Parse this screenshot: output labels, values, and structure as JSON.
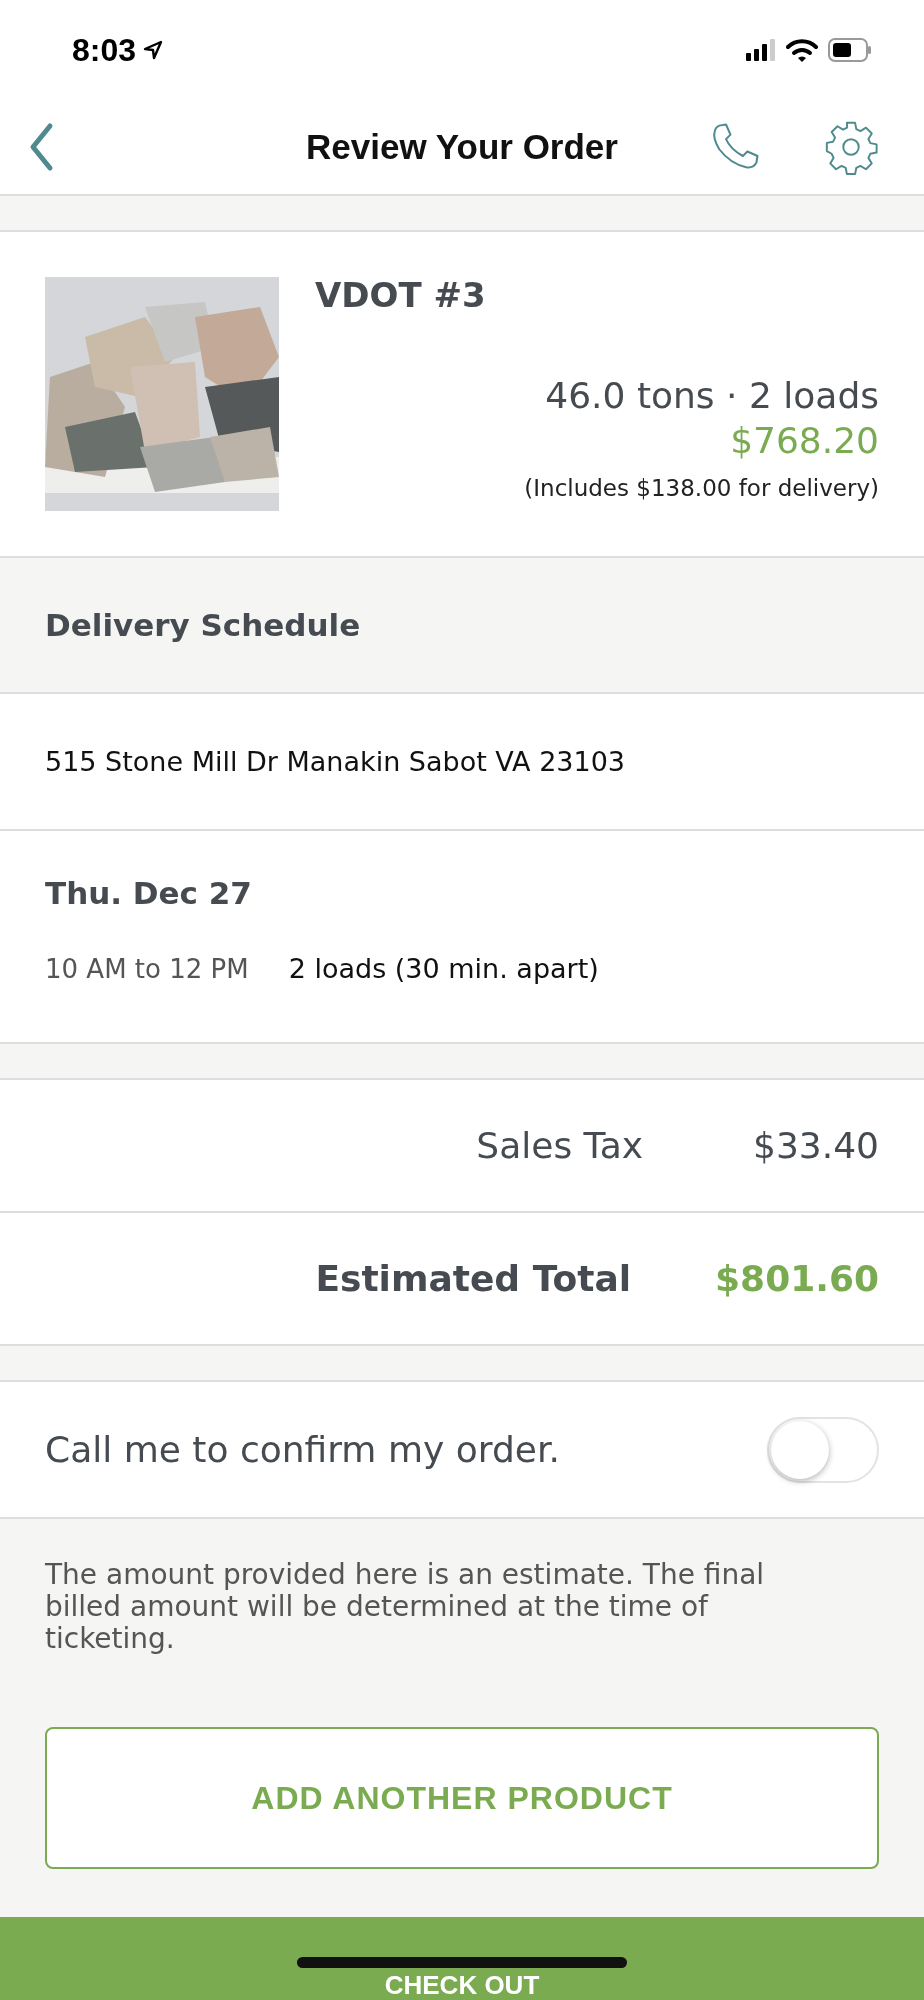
{
  "status_bar": {
    "time": "8:03"
  },
  "nav": {
    "title": "Review Your Order"
  },
  "product": {
    "name": "VDOT #3",
    "quantity": "46.0 tons · 2 loads",
    "price": "$768.20",
    "delivery_note": "(Includes $138.00 for delivery)"
  },
  "delivery_schedule": {
    "heading": "Delivery Schedule",
    "address": "515 Stone Mill Dr Manakin Sabot VA 23103",
    "date": "Thu. Dec 27",
    "time_window": "10 AM to 12 PM",
    "loads": "2 loads (30 min. apart)"
  },
  "summary": [
    {
      "kind": "tax",
      "label": "Sales Tax",
      "value": "$33.40"
    },
    {
      "kind": "total",
      "label": "Estimated Total",
      "value": "$801.60"
    }
  ],
  "confirm_call": {
    "label": "Call me to confirm my order.",
    "on": false
  },
  "disclaimer": "The amount provided here is an estimate. The final billed amount will be determined at the time of ticketing.",
  "add_button": "ADD ANOTHER PRODUCT",
  "checkout_button": "CHECK OUT"
}
